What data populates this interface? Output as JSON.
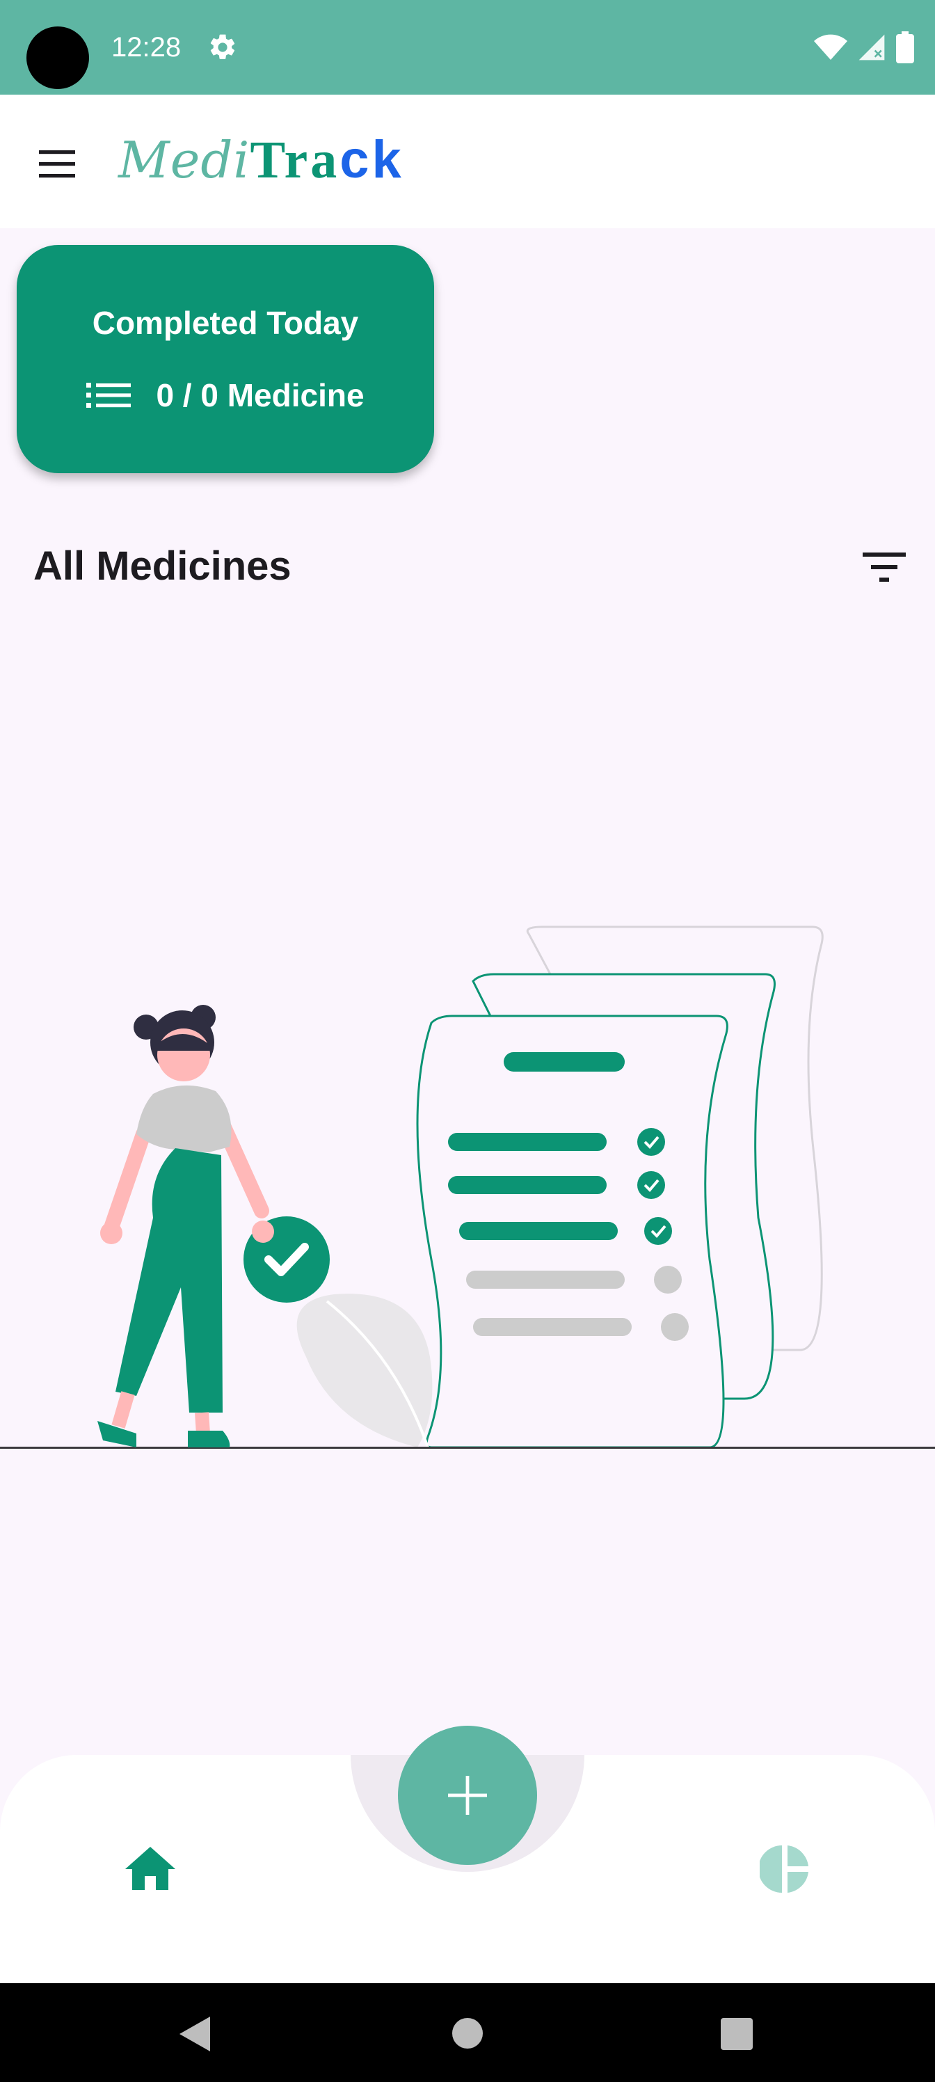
{
  "status_bar": {
    "time": "12:28",
    "icons": [
      "settings-icon",
      "wifi-icon",
      "signal-icon",
      "battery-icon"
    ]
  },
  "app_bar": {
    "logo_part1": "Medi",
    "logo_part2": "Tra",
    "logo_part3": "ck",
    "icons": [
      "menu-icon"
    ]
  },
  "completed_card": {
    "title": "Completed Today",
    "count_text": "0 / 0 Medicine",
    "icon": "list-icon"
  },
  "medicines_section": {
    "title": "All Medicines",
    "icon": "filter-icon"
  },
  "bottom_nav": {
    "items": [
      "home-icon",
      "add-icon",
      "stats-icon"
    ],
    "selected": "home"
  },
  "system_nav": {
    "items": [
      "back-icon",
      "home-button",
      "recents-button"
    ]
  },
  "colors": {
    "primary": "#0c9474",
    "primary_light": "#5eb6a3",
    "logo_blue": "#1c64e8",
    "background": "#fbf5fd"
  }
}
